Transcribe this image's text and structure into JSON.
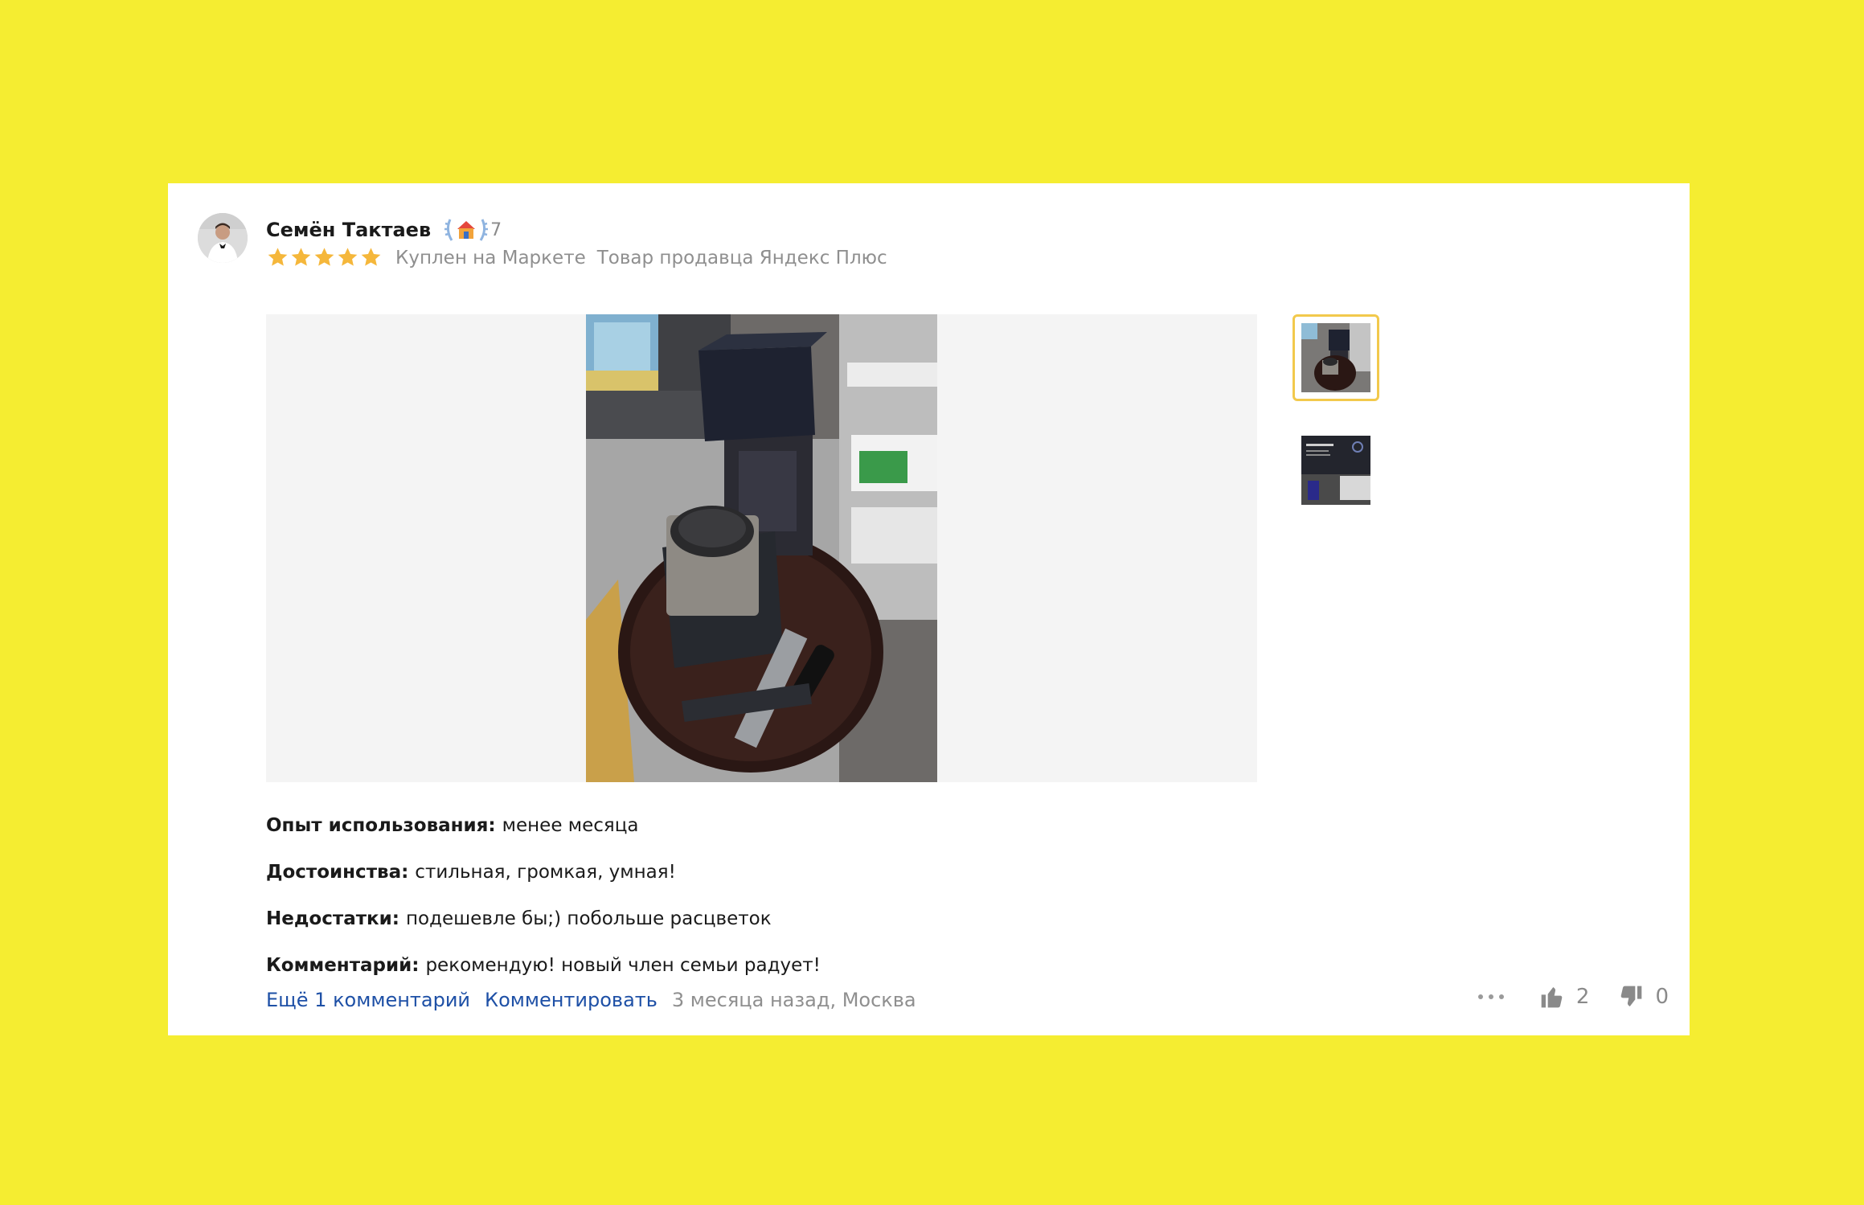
{
  "review": {
    "author": {
      "name": "Семён Тактаев",
      "level": "7",
      "avatar_icon": "user-avatar",
      "badge_icon": "house-laurel-badge"
    },
    "rating": {
      "stars": 5,
      "max": 5,
      "color": "#F5B73B"
    },
    "meta": {
      "purchased": "Куплен на Маркете",
      "seller": "Товар продавца Яндекс Плюс"
    },
    "photos": {
      "main_icon": "review-photo-speaker-box",
      "thumbnails": [
        {
          "icon": "thumb-speaker-box",
          "selected": true
        },
        {
          "icon": "thumb-tv-screen",
          "selected": false
        }
      ],
      "selected_border_color": "#F2C94C"
    },
    "properties": [
      {
        "label": "Опыт использования:",
        "value": "менее месяца"
      },
      {
        "label": "Достоинства:",
        "value": "стильная, громкая, умная!"
      },
      {
        "label": "Недостатки:",
        "value": "подешевле бы;) побольше расцветок"
      },
      {
        "label": "Комментарий:",
        "value": "рекомендую! новый член семьи радует!"
      }
    ],
    "footer": {
      "more_comments": "Ещё 1 комментарий",
      "comment": "Комментировать",
      "date_location": "3 месяца назад, Москва"
    },
    "votes": {
      "likes": "2",
      "dislikes": "0"
    }
  },
  "colors": {
    "page_background": "#F5ED31",
    "card_background": "#FFFFFF",
    "link": "#1E50A6",
    "muted": "#8F8F8F"
  }
}
